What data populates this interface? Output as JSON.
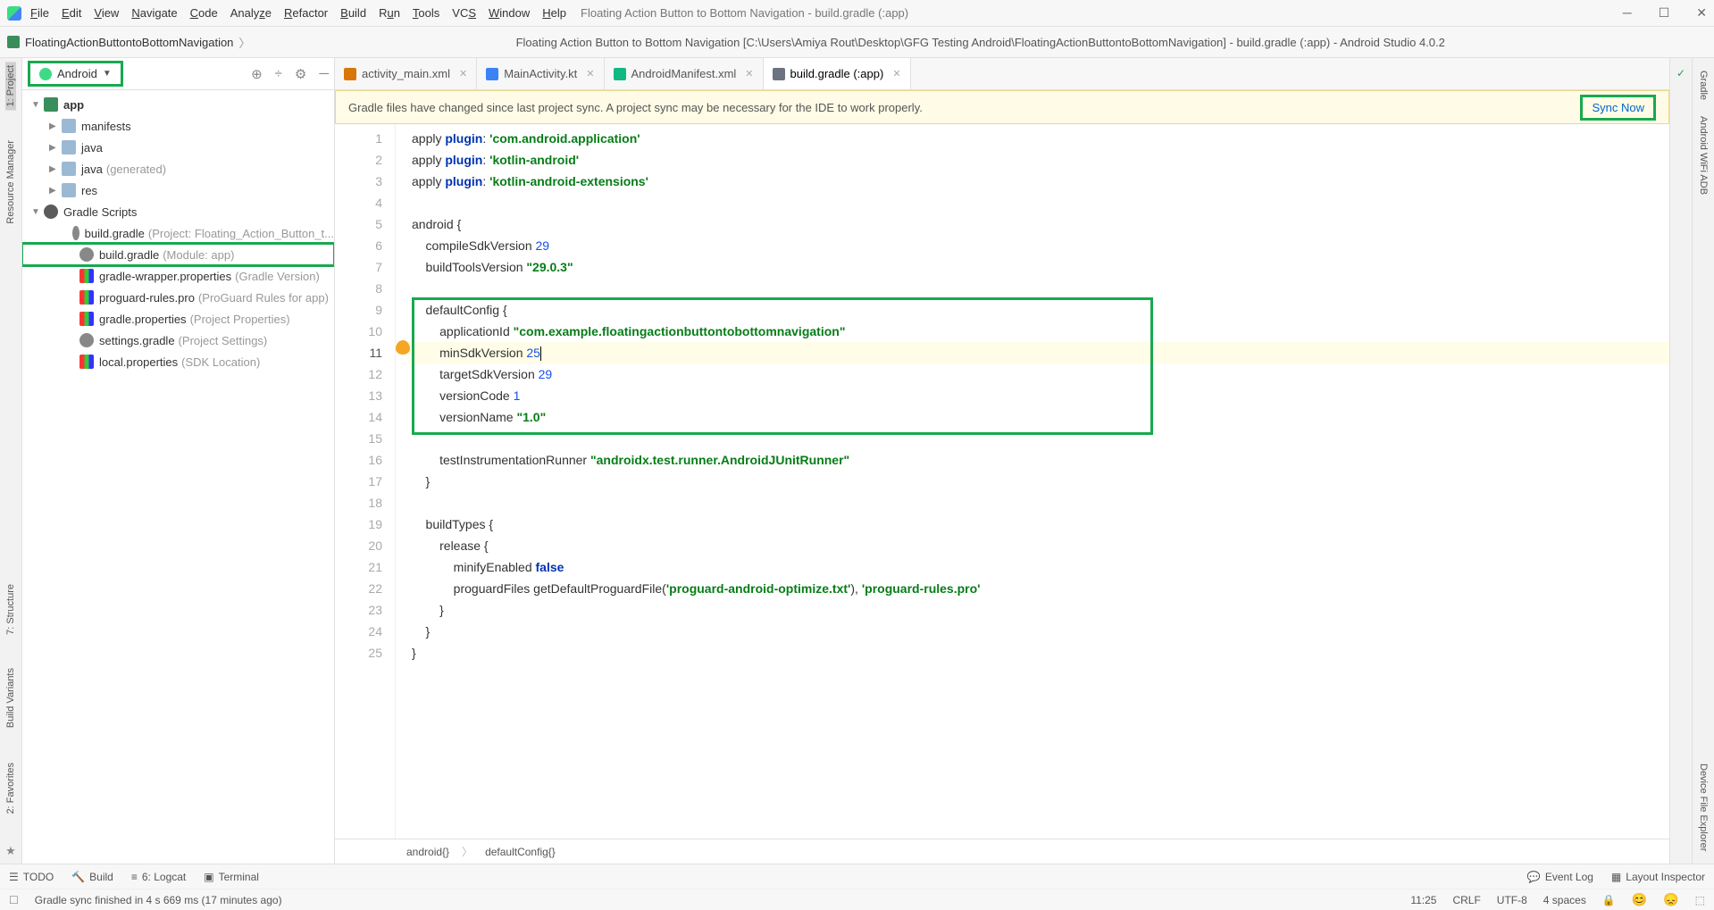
{
  "menu": {
    "file": "File",
    "edit": "Edit",
    "view": "View",
    "navigate": "Navigate",
    "code": "Code",
    "analyze": "Analyze",
    "refactor": "Refactor",
    "build": "Build",
    "run": "Run",
    "tools": "Tools",
    "vcs": "VCS",
    "window": "Window",
    "help": "Help"
  },
  "window_title": "Floating Action Button to Bottom Navigation - build.gradle (:app)",
  "breadcrumb_project": "FloatingActionButtontoBottomNavigation",
  "nav_title": "Floating Action Button to Bottom Navigation [C:\\Users\\Amiya Rout\\Desktop\\GFG Testing Android\\FloatingActionButtontoBottomNavigation] - build.gradle (:app) - Android Studio 4.0.2",
  "left_rails": {
    "project": "1: Project",
    "resource": "Resource Manager",
    "structure": "7: Structure",
    "build": "Build Variants",
    "favorites": "2: Favorites"
  },
  "android_dropdown": "Android",
  "tree": {
    "app": "app",
    "manifests": "manifests",
    "java": "java",
    "java_gen": "java",
    "java_gen_dim": "(generated)",
    "res": "res",
    "gradle_scripts": "Gradle Scripts",
    "bg_project": "build.gradle",
    "bg_project_dim": "(Project: Floating_Action_Button_t...",
    "bg_module": "build.gradle",
    "bg_module_dim": "(Module: app)",
    "wrapper": "gradle-wrapper.properties",
    "wrapper_dim": "(Gradle Version)",
    "proguard": "proguard-rules.pro",
    "proguard_dim": "(ProGuard Rules for app)",
    "gradle_props": "gradle.properties",
    "gradle_props_dim": "(Project Properties)",
    "settings": "settings.gradle",
    "settings_dim": "(Project Settings)",
    "local": "local.properties",
    "local_dim": "(SDK Location)"
  },
  "tabs": {
    "t1": "activity_main.xml",
    "t2": "MainActivity.kt",
    "t3": "AndroidManifest.xml",
    "t4": "build.gradle (:app)"
  },
  "banner_msg": "Gradle files have changed since last project sync. A project sync may be necessary for the IDE to work properly.",
  "sync_now": "Sync Now",
  "code_lines": {
    "l1a": "apply ",
    "l1b": "plugin",
    "l1c": ": ",
    "l1d": "'com.android.application'",
    "l2a": "apply ",
    "l2b": "plugin",
    "l2c": ": ",
    "l2d": "'kotlin-android'",
    "l3a": "apply ",
    "l3b": "plugin",
    "l3c": ": ",
    "l3d": "'kotlin-android-extensions'",
    "l5": "android {",
    "l6a": "    compileSdkVersion ",
    "l6b": "29",
    "l7a": "    buildToolsVersion ",
    "l7b": "\"29.0.3\"",
    "l9": "    defaultConfig {",
    "l10a": "        applicationId ",
    "l10b": "\"com.example.floatingactionbuttontobottomnavigation\"",
    "l11a": "        minSdkVersion ",
    "l11b": "25",
    "l12a": "        targetSdkVersion ",
    "l12b": "29",
    "l13a": "        versionCode ",
    "l13b": "1",
    "l14a": "        versionName ",
    "l14b": "\"1.0\"",
    "l16a": "        testInstrumentationRunner ",
    "l16b": "\"androidx.test.runner.AndroidJUnitRunner\"",
    "l17": "    }",
    "l19": "    buildTypes {",
    "l20": "        release {",
    "l21a": "            minifyEnabled ",
    "l21b": "false",
    "l22a": "            proguardFiles getDefaultProguardFile(",
    "l22b": "'proguard-android-optimize.txt'",
    "l22c": "), ",
    "l22d": "'proguard-rules.pro'",
    "l23": "        }",
    "l24": "    }",
    "l25": "}"
  },
  "crumbs": {
    "c1": "android{}",
    "c2": "defaultConfig{}"
  },
  "right_rails": {
    "gradle": "Gradle",
    "wifi": "Android WiFi ADB",
    "device": "Device File Explorer"
  },
  "bottom": {
    "todo": "TODO",
    "build": "Build",
    "logcat": "6: Logcat",
    "terminal": "Terminal",
    "event": "Event Log",
    "layout": "Layout Inspector"
  },
  "status": {
    "msg": "Gradle sync finished in 4 s 669 ms (17 minutes ago)",
    "pos": "11:25",
    "crlf": "CRLF",
    "enc": "UTF-8",
    "indent": "4 spaces"
  }
}
